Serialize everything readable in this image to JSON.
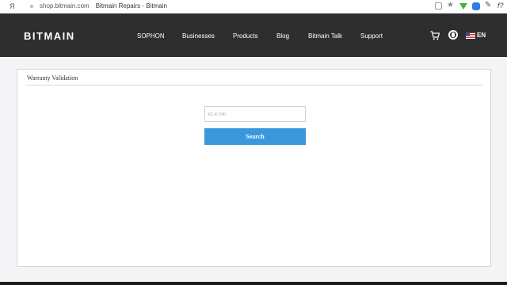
{
  "browser": {
    "ya_glyph": "Я",
    "url": "shop.bitmain.com",
    "page_title": "Bitmain Repairs - Bitmain"
  },
  "header": {
    "logo": "BITMAIN",
    "nav": [
      "SOPHON",
      "Businesses",
      "Products",
      "Blog",
      "Bitmain Talk",
      "Support"
    ],
    "language": "EN"
  },
  "panel": {
    "title": "Warranty Validation",
    "search_placeholder": "KLK306",
    "search_button": "Search"
  },
  "colors": {
    "header_bg": "#2e2e2e",
    "button_bg": "#3a97dc"
  }
}
